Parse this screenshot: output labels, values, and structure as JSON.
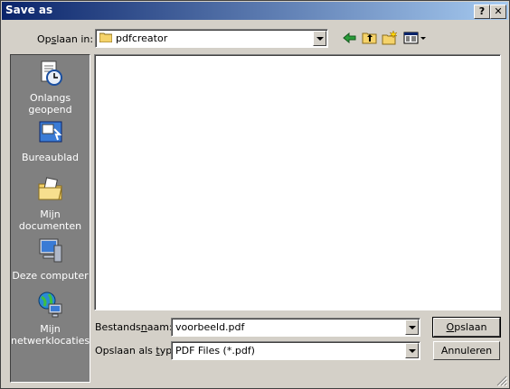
{
  "window": {
    "title": "Save as",
    "help_btn": "?",
    "close_btn": "✕"
  },
  "location": {
    "label": "Opslaan in:",
    "value": "pdfcreator"
  },
  "toolbar": {
    "icons": [
      "back-icon",
      "up-folder-icon",
      "new-folder-icon",
      "view-menu-icon"
    ]
  },
  "places": [
    {
      "label": "Onlangs geopend",
      "icon": "recent-documents-icon"
    },
    {
      "label": "Bureaublad",
      "icon": "desktop-icon"
    },
    {
      "label": "Mijn documenten",
      "icon": "my-documents-icon"
    },
    {
      "label": "Deze computer",
      "icon": "my-computer-icon"
    },
    {
      "label": "Mijn netwerklocaties",
      "icon": "network-places-icon"
    }
  ],
  "filename": {
    "label": "Bestandsnaam:",
    "value": "voorbeeld.pdf"
  },
  "filetype": {
    "label": "Opslaan als type:",
    "value": "PDF Files (*.pdf)"
  },
  "buttons": {
    "save": "Opslaan",
    "cancel": "Annuleren"
  }
}
